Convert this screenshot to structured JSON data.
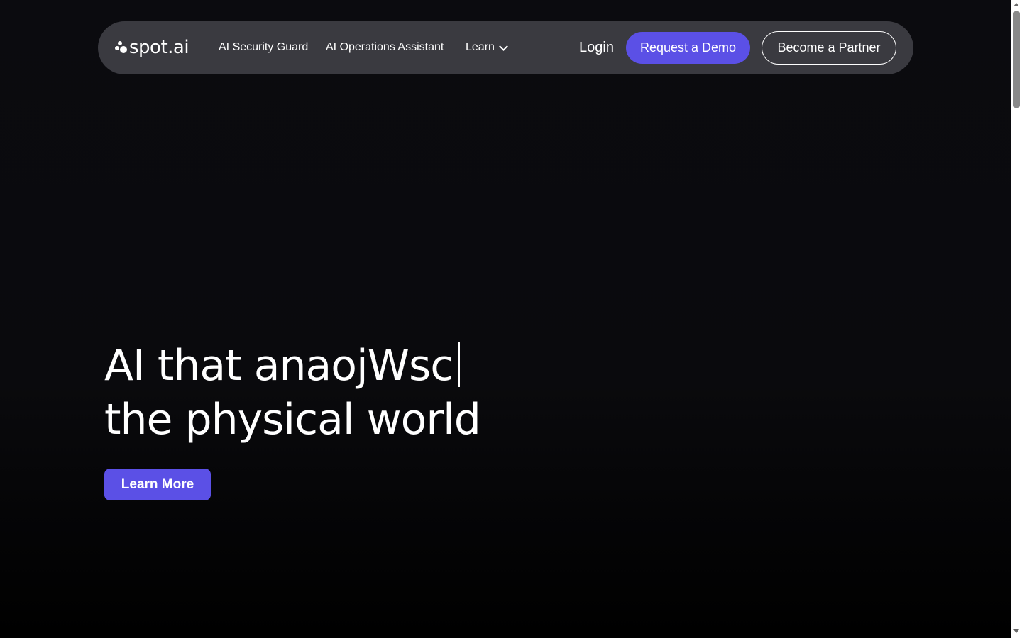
{
  "nav": {
    "logo_text": "spot.ai",
    "links": [
      {
        "label": "AI Security Guard"
      },
      {
        "label": "AI Operations Assistant"
      },
      {
        "label": "Learn"
      }
    ],
    "login_label": "Login",
    "demo_label": "Request a Demo",
    "partner_label": "Become a Partner"
  },
  "hero": {
    "line1": "AI that anaojWsc",
    "line2": "the physical world",
    "cta_label": "Learn More"
  },
  "colors": {
    "accent": "#5b50e6",
    "background": "#0b0b0f",
    "nav_background": "#3a3a40"
  },
  "icons": {
    "logo_mark": "spot-dots-logo-icon",
    "learn_dropdown": "chevron-down-icon"
  }
}
